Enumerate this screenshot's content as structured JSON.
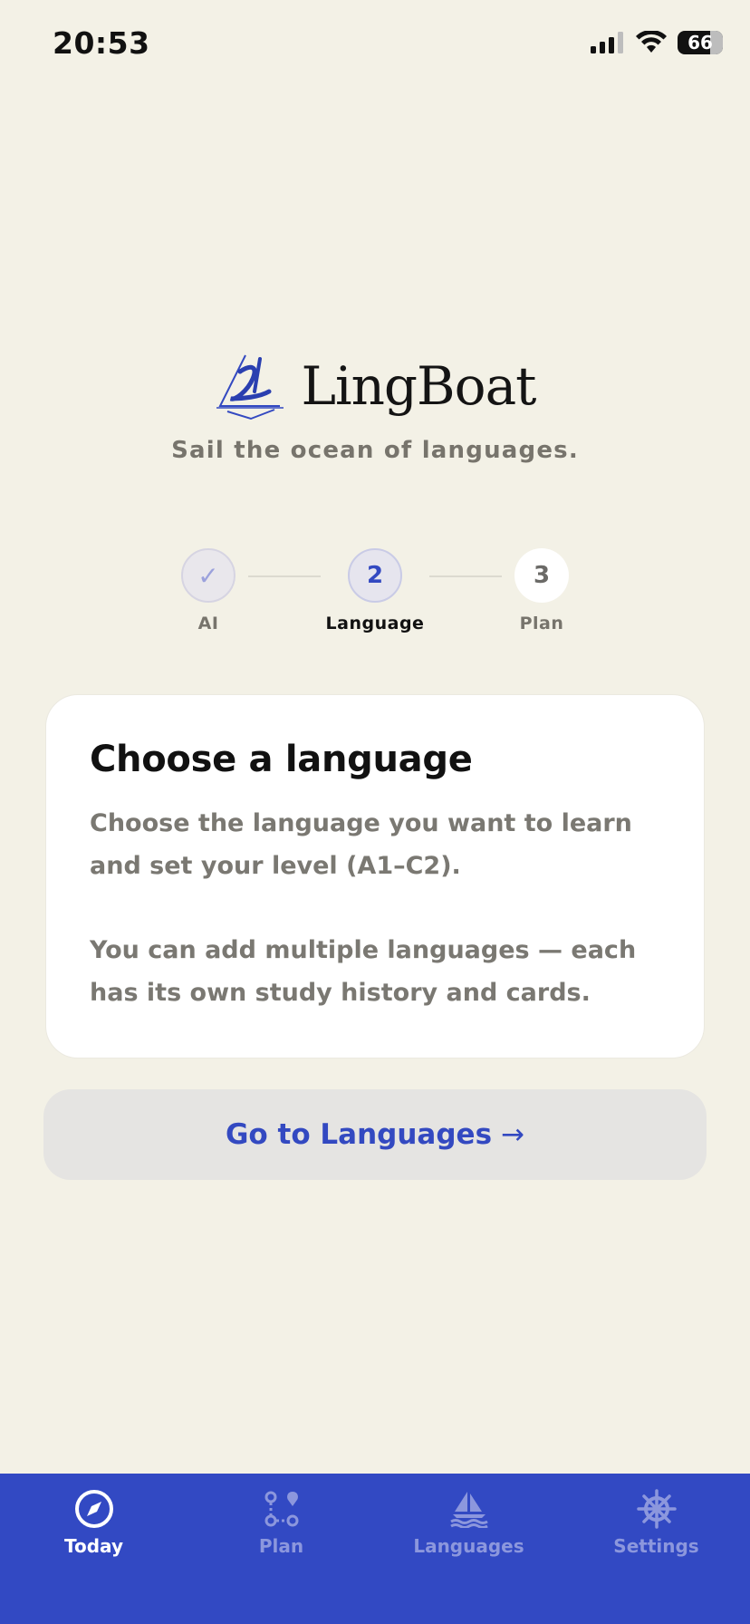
{
  "status_bar": {
    "time": "20:53",
    "battery": "66"
  },
  "brand": {
    "name": "LingBoat",
    "tagline": "Sail the ocean of languages."
  },
  "stepper": {
    "steps": [
      {
        "number": "✓",
        "label": "AI",
        "state": "done"
      },
      {
        "number": "2",
        "label": "Language",
        "state": "active"
      },
      {
        "number": "3",
        "label": "Plan",
        "state": "todo"
      }
    ]
  },
  "card": {
    "title": "Choose a language",
    "paragraph1": "Choose the language you want to learn and set your level (A1–C2).",
    "paragraph2": "You can add multiple languages — each has its own study history and cards."
  },
  "cta": {
    "label": "Go to Languages",
    "arrow": "→"
  },
  "tab_bar": {
    "tabs": [
      {
        "label": "Today",
        "icon": "compass-icon",
        "active": true
      },
      {
        "label": "Plan",
        "icon": "route-icon",
        "active": false
      },
      {
        "label": "Languages",
        "icon": "sailboat-icon",
        "active": false
      },
      {
        "label": "Settings",
        "icon": "ship-wheel-icon",
        "active": false
      }
    ]
  },
  "colors": {
    "background": "#f3f1e6",
    "accent": "#3349c1",
    "tab_bar": "#3249c3"
  }
}
